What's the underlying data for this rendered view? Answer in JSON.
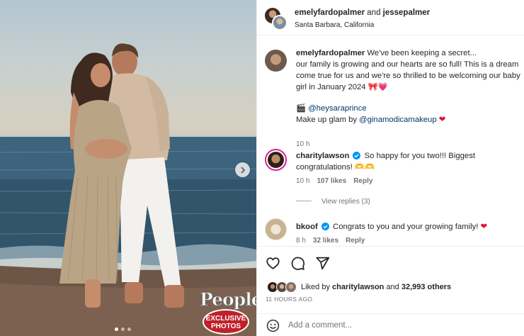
{
  "post": {
    "image_alt": "Couple on the beach at sunset",
    "badge": {
      "brand": "People",
      "line1": "EXCLUSIVE",
      "line2": "PHOTOS"
    },
    "carousel": {
      "count": 3,
      "active": 0
    }
  },
  "header": {
    "user1": "emelyfardopalmer",
    "joiner": " and ",
    "user2": "jessepalmer",
    "location": "Santa Barbara, California"
  },
  "caption": {
    "username": "emelyfardopalmer",
    "line1": "We've been keeping a secret...",
    "line2": "our family is growing and our hearts are so full! This is a dream",
    "line3": "come true for us and we're so thrilled to be welcoming our baby",
    "line4": "girl in January 2024",
    "line4_emoji": "🎀💗",
    "photo_credit_emoji": "🎬",
    "photo_credit": "@heysaraprince",
    "makeup_prefix": "Make up glam by ",
    "makeup_handle": "@ginamodicamakeup",
    "makeup_emoji": "❤",
    "time": "10 h"
  },
  "comments": [
    {
      "username": "charitylawson",
      "verified": true,
      "line1": "So happy for you two!!! Biggest",
      "line2": "congratulations! 🫶🫶",
      "time": "10 h",
      "likes": "107 likes",
      "reply": "Reply",
      "view_replies": "View replies (3)"
    },
    {
      "username": "bkoof",
      "verified": true,
      "text": "Congrats to you and your growing family!",
      "emoji": "❤",
      "time": "8 h",
      "likes": "32 likes",
      "reply": "Reply"
    }
  ],
  "actions": {
    "liked_by_prefix": "Liked by ",
    "liked_by_user": "charitylawson",
    "liked_by_joiner": " and ",
    "liked_by_others": "32,993 others",
    "time_ago": "11 HOURS AGO"
  },
  "add_comment": {
    "placeholder": "Add a comment..."
  },
  "colors": {
    "verified": "#0095f6",
    "heart": "#e0103b",
    "link": "#00376b",
    "muted": "#737373"
  },
  "icons": [
    "chevron-right-icon",
    "heart-icon",
    "comment-icon",
    "share-icon",
    "emoji-icon",
    "verified-icon"
  ]
}
